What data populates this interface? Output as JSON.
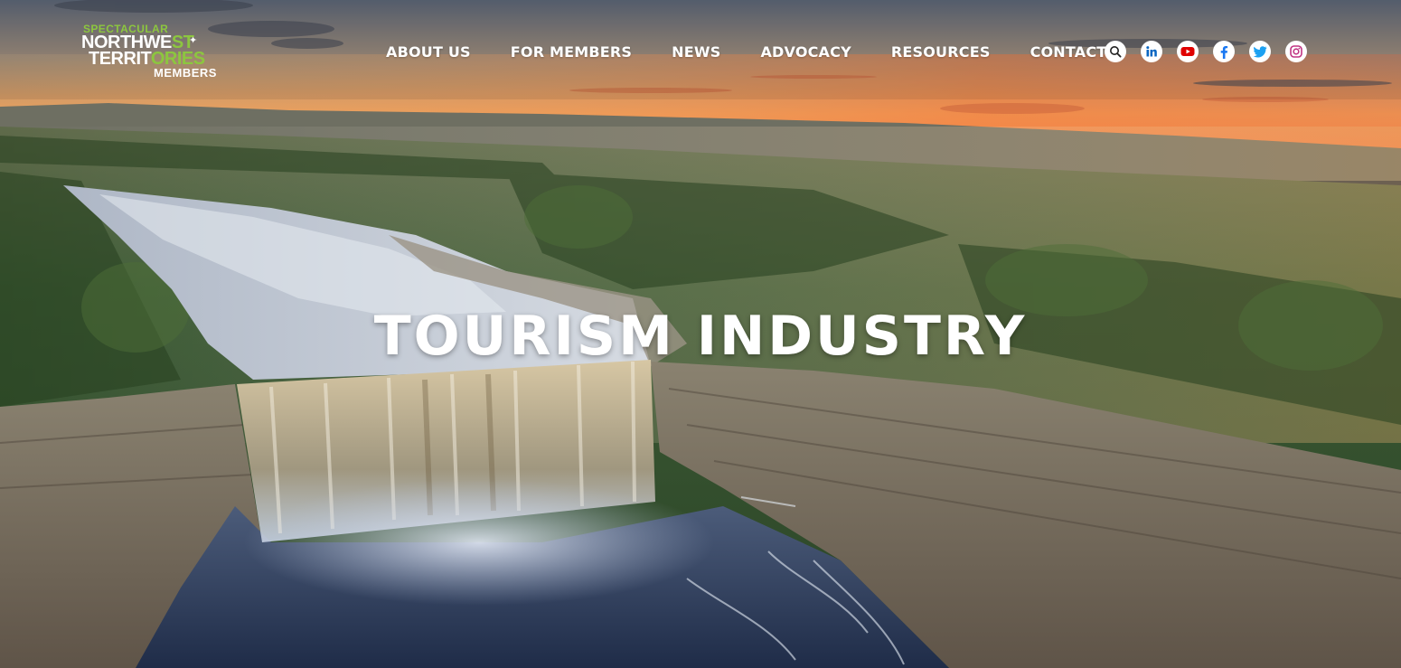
{
  "logo": {
    "top": "SPECTACULAR",
    "line1_a": "NORTHWE",
    "line1_b": "ST",
    "line2_a": "TERRIT",
    "line2_b": "ORIES",
    "bottom": "MEMBERS"
  },
  "nav": {
    "items": [
      {
        "label": "ABOUT US"
      },
      {
        "label": "FOR MEMBERS"
      },
      {
        "label": "NEWS"
      },
      {
        "label": "ADVOCACY"
      },
      {
        "label": "RESOURCES"
      },
      {
        "label": "CONTACT"
      }
    ]
  },
  "social": {
    "icons": [
      "search-icon",
      "linkedin-icon",
      "youtube-icon",
      "facebook-icon",
      "twitter-icon",
      "instagram-icon"
    ]
  },
  "hero": {
    "title": "TOURISM INDUSTRY"
  },
  "colors": {
    "brand_green": "#8cc63f",
    "linkedin": "#0a66c2",
    "youtube": "#e00000",
    "facebook": "#1877f2",
    "twitter": "#1da1f2",
    "instagram": "#c13584"
  }
}
